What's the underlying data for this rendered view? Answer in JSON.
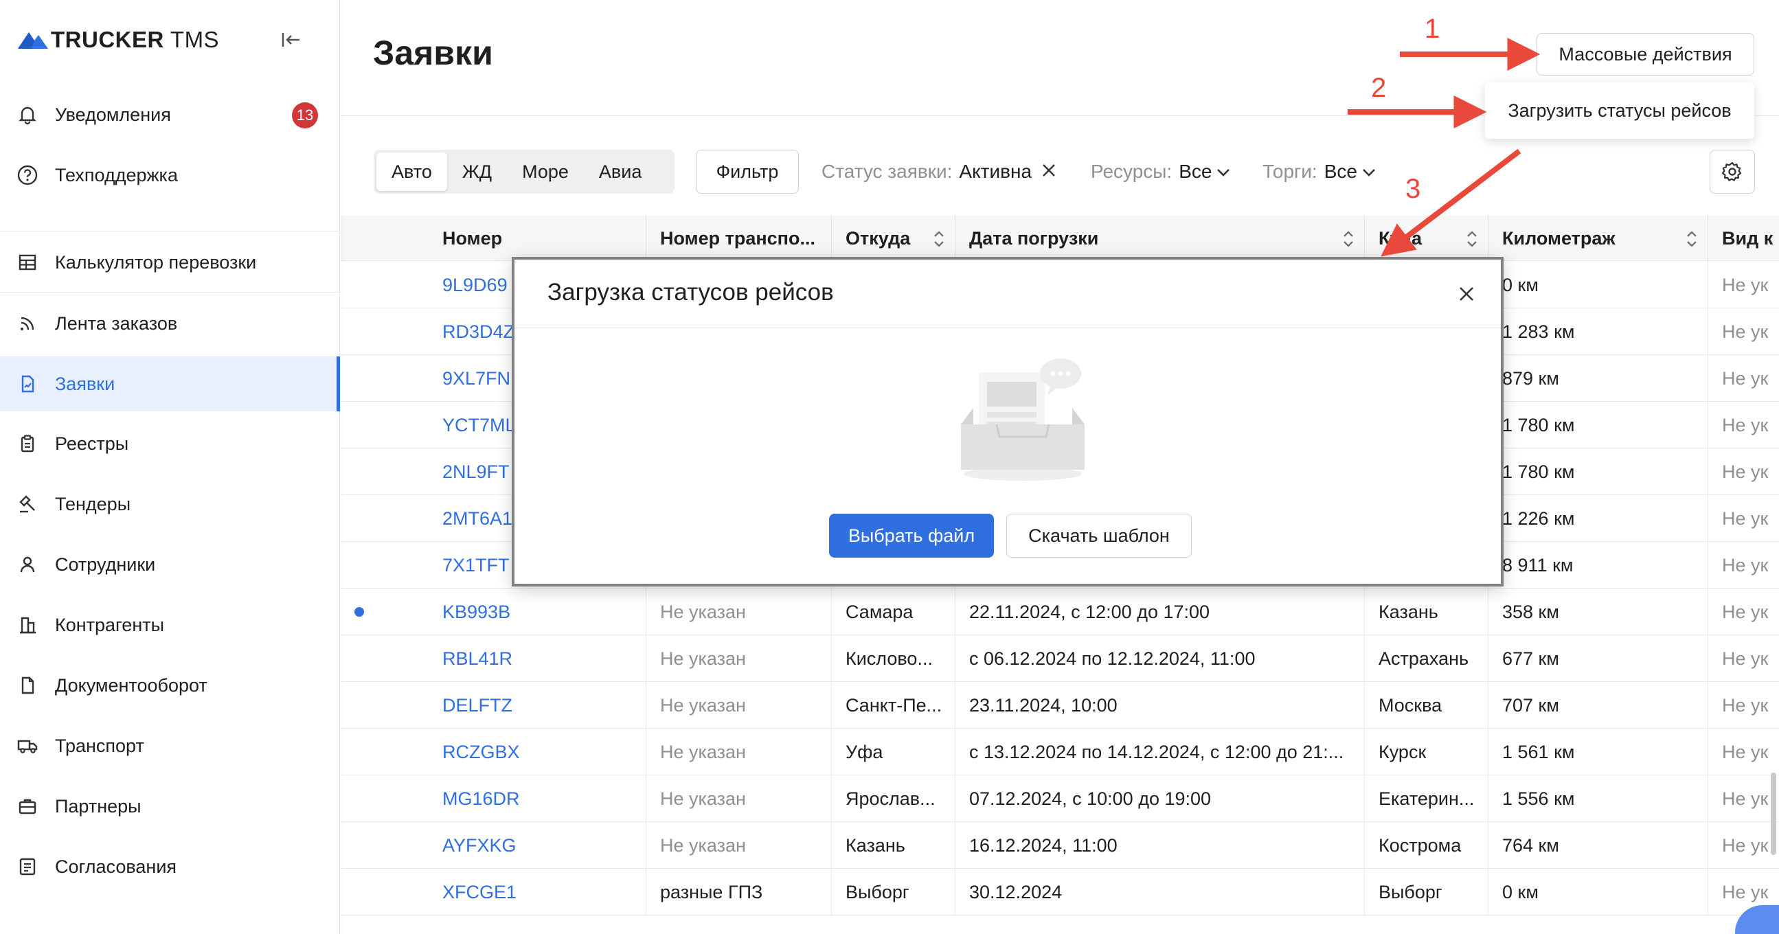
{
  "app": {
    "logo_bold": "TRUCKER",
    "logo_light": "TMS"
  },
  "sidebar": {
    "top_items": [
      {
        "label": "Уведомления",
        "icon": "bell-icon",
        "badge": "13"
      },
      {
        "label": "Техподдержка",
        "icon": "help-circle-icon"
      }
    ],
    "items": [
      {
        "label": "Калькулятор перевозки",
        "icon": "calculator-icon"
      },
      {
        "label": "Лента заказов",
        "icon": "feed-icon"
      },
      {
        "label": "Заявки",
        "icon": "document-icon",
        "active": true
      },
      {
        "label": "Реестры",
        "icon": "clipboard-icon"
      },
      {
        "label": "Тендеры",
        "icon": "gavel-icon"
      },
      {
        "label": "Сотрудники",
        "icon": "user-icon"
      },
      {
        "label": "Контрагенты",
        "icon": "building-icon"
      },
      {
        "label": "Документооборот",
        "icon": "file-icon"
      },
      {
        "label": "Транспорт",
        "icon": "truck-icon"
      },
      {
        "label": "Партнеры",
        "icon": "briefcase-icon"
      },
      {
        "label": "Согласования",
        "icon": "checklist-icon"
      }
    ]
  },
  "header": {
    "title": "Заявки",
    "mass_actions_label": "Массовые действия",
    "mass_actions_menu": [
      "Загрузить статусы рейсов"
    ]
  },
  "toolbar": {
    "transport_tabs": [
      "Авто",
      "ЖД",
      "Море",
      "Авиа"
    ],
    "active_tab": "Авто",
    "filter_label": "Фильтр",
    "filters": [
      {
        "label": "Статус заявки:",
        "value": "Активна"
      },
      {
        "label": "Ресурсы:",
        "value": "Все"
      },
      {
        "label": "Торги:",
        "value": "Все"
      }
    ]
  },
  "table": {
    "columns": [
      "Номер",
      "Номер транспо...",
      "Откуда",
      "Дата погрузки",
      "Куда",
      "Километраж",
      "Вид к"
    ],
    "rows": [
      {
        "num": "9L9D69",
        "transport": "",
        "from": "",
        "date": "",
        "to": "",
        "km": "0 км",
        "kind": "Не ук",
        "dot": false
      },
      {
        "num": "RD3D4Z",
        "transport": "",
        "from": "",
        "date": "",
        "to": "",
        "km": "1 283 км",
        "kind": "Не ук",
        "dot": false
      },
      {
        "num": "9XL7FN",
        "transport": "",
        "from": "",
        "date": "",
        "to": "",
        "km": "879 км",
        "kind": "Не ук",
        "dot": false
      },
      {
        "num": "YCT7ML",
        "transport": "",
        "from": "",
        "date": "",
        "to": "",
        "km": "1 780 км",
        "kind": "Не ук",
        "dot": false
      },
      {
        "num": "2NL9FT",
        "transport": "",
        "from": "",
        "date": "",
        "to": "",
        "km": "1 780 км",
        "kind": "Не ук",
        "dot": false
      },
      {
        "num": "2MT6A1",
        "transport": "",
        "from": "",
        "date": "",
        "to": "",
        "km": "1 226 км",
        "kind": "Не ук",
        "dot": false
      },
      {
        "num": "7X1TFT",
        "transport": "",
        "from": "",
        "date": "",
        "to": "",
        "km": "8 911 км",
        "kind": "Не ук",
        "dot": false
      },
      {
        "num": "KB993B",
        "transport": "Не указан",
        "from": "Самара",
        "date": "22.11.2024, с 12:00 до 17:00",
        "to": "Казань",
        "km": "358 км",
        "kind": "Не ук",
        "dot": true
      },
      {
        "num": "RBL41R",
        "transport": "Не указан",
        "from": "Кислово...",
        "date": "с 06.12.2024 по 12.12.2024, 11:00",
        "to": "Астрахань",
        "km": "677 км",
        "kind": "Не ук",
        "dot": false
      },
      {
        "num": "DELFTZ",
        "transport": "Не указан",
        "from": "Санкт-Пе...",
        "date": "23.11.2024, 10:00",
        "to": "Москва",
        "km": "707 км",
        "kind": "Не ук",
        "dot": false
      },
      {
        "num": "RCZGBX",
        "transport": "Не указан",
        "from": "Уфа",
        "date": "с 13.12.2024 по 14.12.2024, с 12:00 до 21:...",
        "to": "Курск",
        "km": "1 561 км",
        "kind": "Не ук",
        "dot": false
      },
      {
        "num": "MG16DR",
        "transport": "Не указан",
        "from": "Ярослав...",
        "date": "07.12.2024, с 10:00 до 19:00",
        "to": "Екатерин...",
        "km": "1 556 км",
        "kind": "Не ук",
        "dot": false
      },
      {
        "num": "AYFXKG",
        "transport": "Не указан",
        "from": "Казань",
        "date": "16.12.2024, 11:00",
        "to": "Кострома",
        "km": "764 км",
        "kind": "Не ук",
        "dot": false
      },
      {
        "num": "XFCGE1",
        "transport": "разные ГПЗ",
        "from": "Выборг",
        "date": "30.12.2024",
        "to": "Выборг",
        "km": "0 км",
        "kind": "Не ук",
        "dot": false
      }
    ]
  },
  "modal": {
    "title": "Загрузка статусов рейсов",
    "primary_button": "Выбрать файл",
    "secondary_button": "Скачать шаблон"
  },
  "annotations": {
    "steps": [
      "1",
      "2",
      "3"
    ],
    "color": "#e8493a"
  },
  "colors": {
    "accent": "#2f6fe0",
    "badge": "#d1363b",
    "muted": "#8f8f8f"
  }
}
